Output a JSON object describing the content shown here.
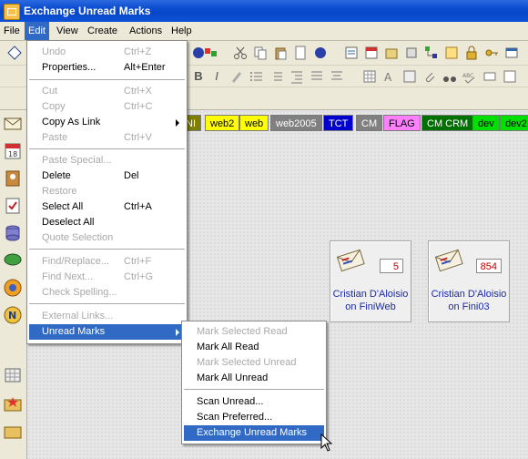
{
  "window": {
    "title": "Exchange Unread Marks"
  },
  "menubar": [
    {
      "label": "File"
    },
    {
      "label": "Edit"
    },
    {
      "label": "View"
    },
    {
      "label": "Create"
    },
    {
      "label": "Actions"
    },
    {
      "label": "Help"
    }
  ],
  "edit_menu": [
    {
      "label": "Undo",
      "shortcut": "Ctrl+Z",
      "enabled": false
    },
    {
      "label": "Properties...",
      "shortcut": "Alt+Enter",
      "enabled": true
    },
    {
      "label": "Cut",
      "shortcut": "Ctrl+X",
      "enabled": false
    },
    {
      "label": "Copy",
      "shortcut": "Ctrl+C",
      "enabled": false
    },
    {
      "label": "Copy As Link",
      "shortcut": "",
      "enabled": true
    },
    {
      "label": "Paste",
      "shortcut": "Ctrl+V",
      "enabled": false
    },
    {
      "label": "Paste Special...",
      "shortcut": "",
      "enabled": false
    },
    {
      "label": "Delete",
      "shortcut": "Del",
      "enabled": true
    },
    {
      "label": "Restore",
      "shortcut": "",
      "enabled": false
    },
    {
      "label": "Select All",
      "shortcut": "Ctrl+A",
      "enabled": true
    },
    {
      "label": "Deselect All",
      "shortcut": "",
      "enabled": true
    },
    {
      "label": "Quote Selection",
      "shortcut": "",
      "enabled": false
    },
    {
      "label": "Find/Replace...",
      "shortcut": "Ctrl+F",
      "enabled": false
    },
    {
      "label": "Find Next...",
      "shortcut": "Ctrl+G",
      "enabled": false
    },
    {
      "label": "Check Spelling...",
      "shortcut": "",
      "enabled": false
    },
    {
      "label": "External Links...",
      "shortcut": "",
      "enabled": false
    },
    {
      "label": "Unread Marks",
      "shortcut": "",
      "enabled": true
    }
  ],
  "unread_submenu": [
    {
      "label": "Mark Selected Read",
      "enabled": false
    },
    {
      "label": "Mark All Read",
      "enabled": true
    },
    {
      "label": "Mark Selected Unread",
      "enabled": false
    },
    {
      "label": "Mark All Unread",
      "enabled": true
    },
    {
      "label": "Scan Unread...",
      "enabled": true
    },
    {
      "label": "Scan Preferred...",
      "enabled": true
    },
    {
      "label": "Exchange Unread Marks",
      "enabled": true
    }
  ],
  "tags": [
    {
      "label": "NI",
      "bg": "#808000",
      "fg": "#ffffff"
    },
    {
      "label": "web2",
      "bg": "#ffff00",
      "fg": "#000000"
    },
    {
      "label": "web",
      "bg": "#ffff00",
      "fg": "#000000"
    },
    {
      "label": "web2005",
      "bg": "#808080",
      "fg": "#ffffff"
    },
    {
      "label": "TCT",
      "bg": "#0000cc",
      "fg": "#ffffff"
    },
    {
      "label": "CM",
      "bg": "#808080",
      "fg": "#ffffff"
    },
    {
      "label": "FLAG",
      "bg": "#ff80ff",
      "fg": "#000000"
    },
    {
      "label": "CM CRM",
      "bg": "#007000",
      "fg": "#ffffff"
    },
    {
      "label": "dev",
      "bg": "#00e000",
      "fg": "#000000"
    },
    {
      "label": "dev2",
      "bg": "#00e000",
      "fg": "#000000"
    }
  ],
  "cards": [
    {
      "count": "5",
      "name_line1": "Cristian D'Aloisio",
      "name_line2": "on FiniWeb"
    },
    {
      "count": "854",
      "name_line1": "Cristian D'Aloisio",
      "name_line2": "on Fini03"
    }
  ],
  "colors": {
    "accent": "#316ac5",
    "disabled": "#a9a9a9",
    "count_text": "#c00000",
    "card_name": "#1c2aa6"
  }
}
